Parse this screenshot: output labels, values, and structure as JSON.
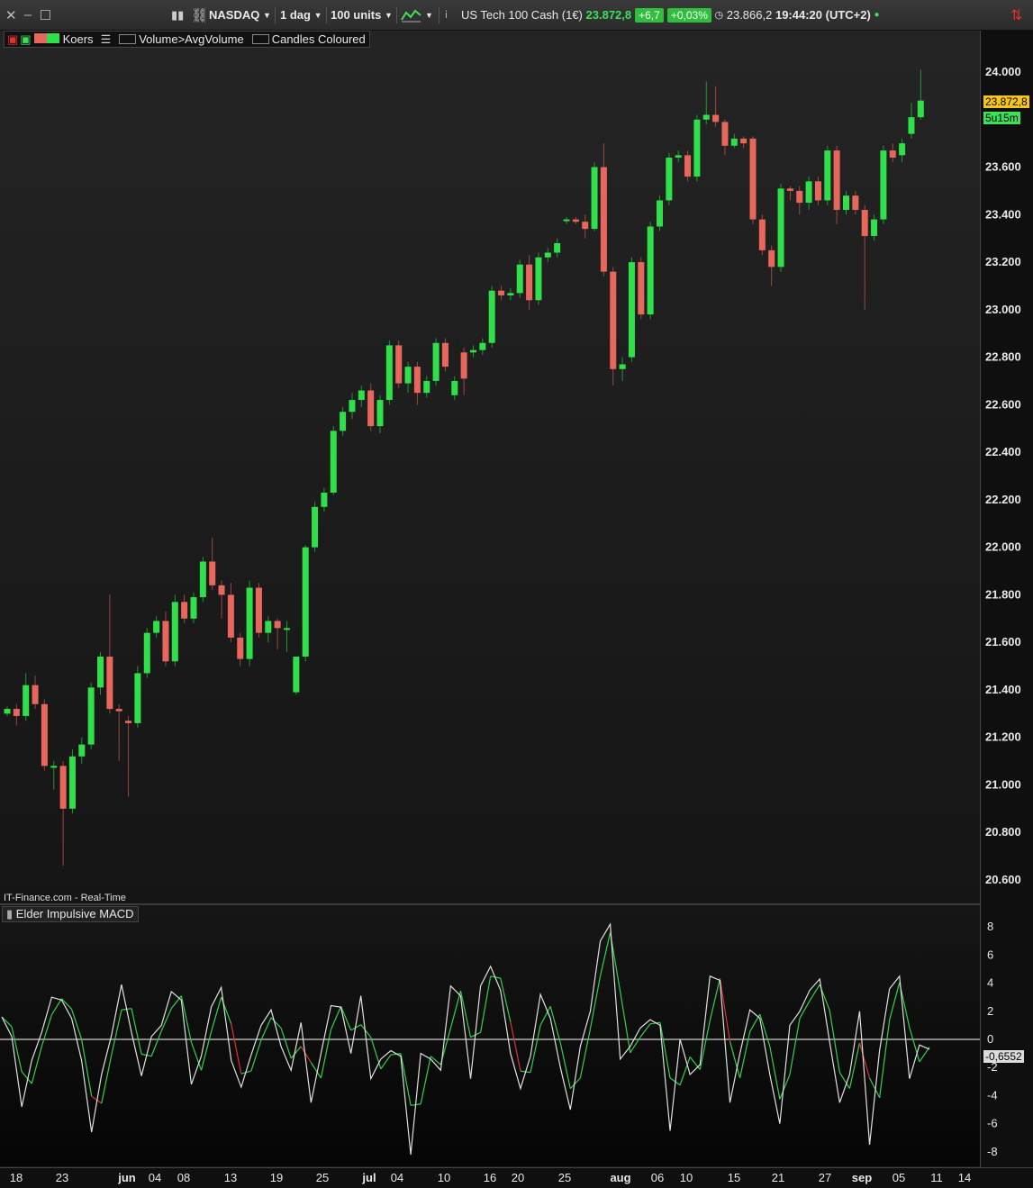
{
  "toolbar": {
    "market": "NASDAQ",
    "timeframe": "1 dag",
    "units": "100 units",
    "instrument": "US Tech 100 Cash (1€)",
    "price": "23.872,8",
    "change": "+6,7",
    "change_pct": "+0,03%",
    "bid": "23.866,2",
    "time": "19:44:20 (UTC+2)"
  },
  "legend": {
    "series": "Koers",
    "indicator1": "Volume>AvgVolume",
    "indicator2": "Candles Coloured"
  },
  "source": "IT-Finance.com - Real-Time",
  "macd_title": "Elder Impulsive MACD",
  "price_label": "23.872,8",
  "countdown": "5u15m",
  "macd_label": "-0,6552",
  "colors": {
    "up": "#2fe04a",
    "down": "#e8675d",
    "macd": "#e0e0e0",
    "signal_up": "#2ed24a",
    "signal_down": "#e03030"
  },
  "chart_data": [
    {
      "type": "candlestick",
      "title": "US Tech 100 Cash (1€)",
      "y_ticks": [
        "24.000",
        "23.800",
        "23.600",
        "23.400",
        "23.200",
        "23.000",
        "22.800",
        "22.600",
        "22.400",
        "22.200",
        "22.000",
        "21.800",
        "21.600",
        "21.400",
        "21.200",
        "21.000",
        "20.800",
        "20.600"
      ],
      "ylim": [
        20500,
        24100
      ],
      "x_ticks": [
        "18",
        "23",
        "jun",
        "04",
        "08",
        "13",
        "19",
        "25",
        "jul",
        "04",
        "10",
        "16",
        "20",
        "25",
        "aug",
        "06",
        "10",
        "15",
        "21",
        "27",
        "sep",
        "05",
        "11",
        "14"
      ],
      "candles": [
        [
          21300,
          21320,
          21290,
          21330
        ],
        [
          21320,
          21290,
          21250,
          21340
        ],
        [
          21290,
          21420,
          21270,
          21470
        ],
        [
          21420,
          21340,
          21320,
          21460
        ],
        [
          21340,
          21080,
          21060,
          21360
        ],
        [
          21080,
          21080,
          20980,
          21100
        ],
        [
          21080,
          20900,
          20660,
          21100
        ],
        [
          20900,
          21120,
          20880,
          21150
        ],
        [
          21120,
          21170,
          21090,
          21200
        ],
        [
          21170,
          21410,
          21150,
          21430
        ],
        [
          21410,
          21540,
          21380,
          21560
        ],
        [
          21540,
          21320,
          21300,
          21800
        ],
        [
          21320,
          21310,
          21100,
          21340
        ],
        [
          21270,
          21260,
          20950,
          21290
        ],
        [
          21260,
          21470,
          21240,
          21500
        ],
        [
          21470,
          21640,
          21450,
          21660
        ],
        [
          21640,
          21690,
          21620,
          21710
        ],
        [
          21690,
          21520,
          21500,
          21730
        ],
        [
          21520,
          21770,
          21500,
          21800
        ],
        [
          21770,
          21700,
          21680,
          21800
        ],
        [
          21700,
          21790,
          21680,
          21810
        ],
        [
          21790,
          21940,
          21770,
          21960
        ],
        [
          21940,
          21840,
          21820,
          22040
        ],
        [
          21840,
          21800,
          21700,
          21860
        ],
        [
          21800,
          21620,
          21600,
          21850
        ],
        [
          21620,
          21530,
          21500,
          21640
        ],
        [
          21530,
          21830,
          21500,
          21860
        ],
        [
          21830,
          21640,
          21620,
          21850
        ],
        [
          21640,
          21690,
          21600,
          21710
        ],
        [
          21690,
          21660,
          21570,
          21700
        ],
        [
          21660,
          21660,
          21560,
          21690
        ],
        [
          21390,
          21540,
          21380,
          21540
        ],
        [
          21540,
          22000,
          21520,
          22010
        ],
        [
          22000,
          22170,
          21980,
          22190
        ],
        [
          22170,
          22230,
          22150,
          22250
        ],
        [
          22230,
          22490,
          22220,
          22510
        ],
        [
          22490,
          22570,
          22470,
          22590
        ],
        [
          22570,
          22620,
          22540,
          22650
        ],
        [
          22620,
          22660,
          22590,
          22680
        ],
        [
          22660,
          22510,
          22490,
          22690
        ],
        [
          22510,
          22620,
          22480,
          22640
        ],
        [
          22620,
          22850,
          22600,
          22870
        ],
        [
          22850,
          22690,
          22670,
          22870
        ],
        [
          22690,
          22760,
          22650,
          22780
        ],
        [
          22760,
          22650,
          22600,
          22780
        ],
        [
          22650,
          22700,
          22630,
          22720
        ],
        [
          22700,
          22860,
          22680,
          22880
        ],
        [
          22860,
          22760,
          22740,
          22880
        ],
        [
          22640,
          22700,
          22620,
          22720
        ],
        [
          22820,
          22710,
          22640,
          22840
        ],
        [
          22820,
          22830,
          22800,
          22850
        ],
        [
          22830,
          22860,
          22810,
          22880
        ],
        [
          22860,
          23080,
          22840,
          23100
        ],
        [
          23080,
          23060,
          23040,
          23100
        ],
        [
          23060,
          23070,
          23040,
          23090
        ],
        [
          23070,
          23190,
          23050,
          23210
        ],
        [
          23190,
          23040,
          23000,
          23230
        ],
        [
          23040,
          23220,
          23020,
          23240
        ],
        [
          23220,
          23240,
          23200,
          23260
        ],
        [
          23240,
          23280,
          23220,
          23300
        ],
        [
          23380,
          23380,
          23360,
          23390
        ],
        [
          23380,
          23370,
          23360,
          23390
        ],
        [
          23370,
          23340,
          23300,
          23400
        ],
        [
          23340,
          23600,
          23330,
          23620
        ],
        [
          23600,
          23160,
          23140,
          23700
        ],
        [
          23160,
          22750,
          22680,
          23180
        ],
        [
          22750,
          22770,
          22700,
          22800
        ],
        [
          22800,
          23200,
          22780,
          23220
        ],
        [
          23200,
          22980,
          22960,
          23220
        ],
        [
          22980,
          23350,
          22960,
          23370
        ],
        [
          23350,
          23460,
          23330,
          23480
        ],
        [
          23460,
          23640,
          23440,
          23660
        ],
        [
          23640,
          23650,
          23620,
          23670
        ],
        [
          23650,
          23560,
          23540,
          23670
        ],
        [
          23560,
          23800,
          23540,
          23820
        ],
        [
          23800,
          23820,
          23780,
          23960
        ],
        [
          23820,
          23790,
          23770,
          23940
        ],
        [
          23790,
          23690,
          23650,
          23800
        ],
        [
          23690,
          23720,
          23680,
          23740
        ],
        [
          23720,
          23700,
          23680,
          23730
        ],
        [
          23720,
          23380,
          23360,
          23730
        ],
        [
          23380,
          23250,
          23230,
          23400
        ],
        [
          23250,
          23180,
          23100,
          23270
        ],
        [
          23180,
          23510,
          23160,
          23530
        ],
        [
          23510,
          23500,
          23460,
          23520
        ],
        [
          23500,
          23450,
          23400,
          23520
        ],
        [
          23450,
          23540,
          23420,
          23560
        ],
        [
          23540,
          23460,
          23440,
          23560
        ],
        [
          23460,
          23670,
          23440,
          23690
        ],
        [
          23670,
          23420,
          23360,
          23690
        ],
        [
          23420,
          23480,
          23400,
          23500
        ],
        [
          23480,
          23420,
          23400,
          23500
        ],
        [
          23420,
          23310,
          23000,
          23440
        ],
        [
          23310,
          23380,
          23290,
          23400
        ],
        [
          23380,
          23670,
          23360,
          23690
        ],
        [
          23670,
          23640,
          23620,
          23700
        ],
        [
          23650,
          23700,
          23620,
          23720
        ],
        [
          23740,
          23810,
          23720,
          23870
        ],
        [
          23810,
          23880,
          23800,
          24010
        ]
      ],
      "last_price": 23872.8
    },
    {
      "type": "line",
      "title": "Elder Impulsive MACD",
      "y_ticks": [
        "8",
        "6",
        "4",
        "2",
        "0",
        "-2",
        "-4",
        "-6",
        "-8"
      ],
      "ylim": [
        -8.8,
        8.6
      ],
      "series": [
        {
          "values": [
            1.6,
            0.2,
            -4.8,
            -1.5,
            0.5,
            3.0,
            2.8,
            1.5,
            -1.5,
            -6.6,
            -2.5,
            0.3,
            3.9,
            0.5,
            -2.6,
            0.2,
            1.0,
            3.4,
            2.8,
            -3.2,
            -1.2,
            2.3,
            3.7,
            -1.5,
            -3.4,
            -1.1,
            1.0,
            2.1,
            -0.5,
            -2.2,
            1.2,
            -4.5,
            -1.0,
            2.4,
            2.3,
            -1.0,
            3.1,
            -2.8,
            -1.4,
            -0.8,
            -1.2,
            -8.2,
            -1.0,
            -1.4,
            -2.2,
            3.8,
            3.1,
            -2.8,
            3.8,
            5.2,
            3.5,
            -1.0,
            -3.5,
            -1.2,
            3.2,
            1.5,
            -2.0,
            -5.0,
            -0.5,
            2.0,
            7.0,
            8.2,
            -1.4,
            -0.5,
            0.8,
            1.4,
            1.0,
            -6.5,
            0.0,
            -2.5,
            -1.8,
            4.5,
            4.2,
            -4.5,
            -1.0,
            2.1,
            1.5,
            -2.5,
            -6.0,
            1.0,
            2.0,
            3.5,
            4.3,
            -0.2,
            -4.5,
            -2.5,
            2.0,
            -7.5,
            -0.8,
            3.6,
            4.5,
            -2.8,
            -0.4,
            -0.7
          ]
        }
      ],
      "last_value": -0.6552
    }
  ]
}
